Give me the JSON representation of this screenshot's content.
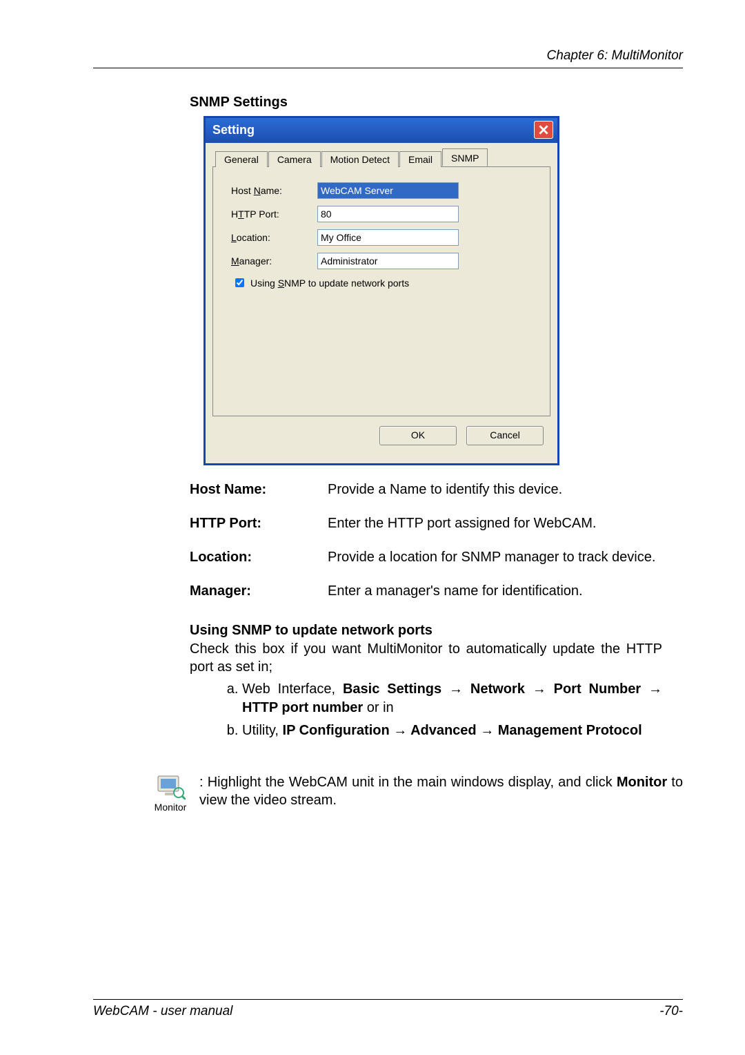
{
  "header": {
    "chapter": "Chapter 6: MultiMonitor"
  },
  "section_title": "SNMP Settings",
  "dialog": {
    "title": "Setting",
    "tabs": {
      "general": "General",
      "camera": "Camera",
      "motion": "Motion Detect",
      "email": "Email",
      "snmp": "SNMP"
    },
    "labels": {
      "host": "Host Name:",
      "http": "HTTP Port:",
      "location": "Location:",
      "manager": "Manager:",
      "checkbox": "Using SNMP to update network ports"
    },
    "accesskeys": {
      "host": "N",
      "http": "T",
      "location": "L",
      "manager": "M",
      "checkbox": "S"
    },
    "values": {
      "host": "WebCAM Server",
      "http": "80",
      "location": "My Office",
      "manager": "Administrator"
    },
    "buttons": {
      "ok": "OK",
      "cancel": "Cancel"
    }
  },
  "defs": {
    "host": {
      "term": "Host Name:",
      "desc": "Provide a Name to identify this device."
    },
    "http": {
      "term": "HTTP Port:",
      "desc": "Enter the HTTP port assigned for WebCAM."
    },
    "location": {
      "term": "Location:",
      "desc": "Provide a location for SNMP manager to track device."
    },
    "manager": {
      "term": "Manager:",
      "desc": "Enter a manager's name for identification."
    }
  },
  "snmp_sub": {
    "heading": "Using SNMP to update network ports",
    "intro": "Check this box if you want MultiMonitor to automatically update the HTTP port as set in;",
    "item_a_prefix": "Web Interface, ",
    "item_a_bold1": "Basic Settings → Network → Port Number → HTTP port number",
    "item_a_suffix": " or in",
    "item_b_prefix": "Utility, ",
    "item_b_bold": "IP Configuration → Advanced → Management Protocol"
  },
  "monitor": {
    "label": "Monitor",
    "prefix": ": Highlight the WebCAM unit in the main windows display, and click ",
    "bold": "Monitor",
    "suffix": " to view the video stream."
  },
  "footer": {
    "left": "WebCAM - user manual",
    "right": "-70-"
  }
}
